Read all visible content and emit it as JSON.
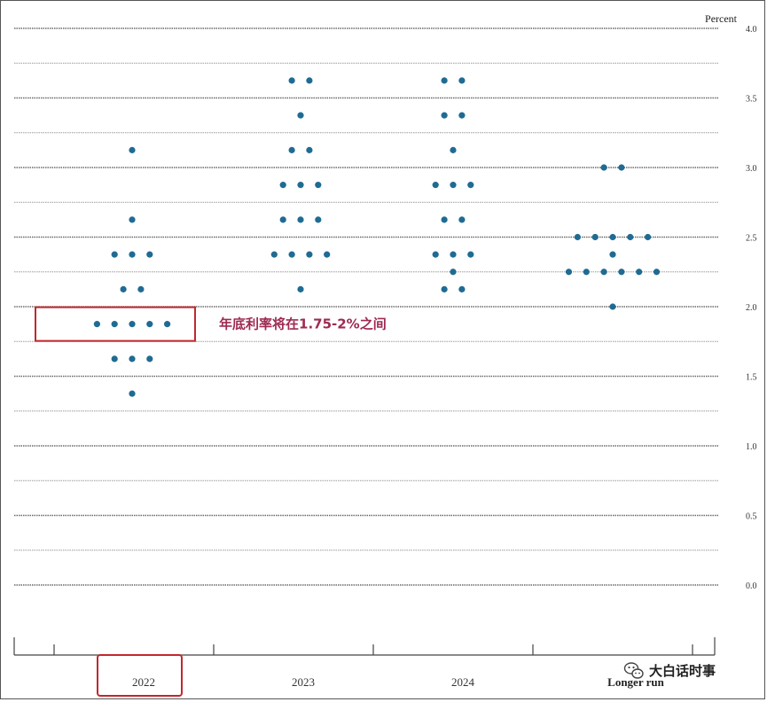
{
  "chart_data": {
    "type": "scatter",
    "y_unit_label": "Percent",
    "ylim": [
      0.0,
      4.0
    ],
    "y_ticks": [
      "0.0",
      "0.5",
      "1.0",
      "1.5",
      "2.0",
      "2.5",
      "3.0",
      "3.5",
      "4.0"
    ],
    "categories": [
      "2022",
      "2023",
      "2024",
      "Longer run"
    ],
    "grid": true,
    "marker_color": "#1f6b93",
    "dots": [
      {
        "category": "2022",
        "rate": 3.125,
        "count": 1
      },
      {
        "category": "2022",
        "rate": 2.625,
        "count": 1
      },
      {
        "category": "2022",
        "rate": 2.375,
        "count": 3
      },
      {
        "category": "2022",
        "rate": 2.125,
        "count": 2
      },
      {
        "category": "2022",
        "rate": 1.875,
        "count": 5
      },
      {
        "category": "2022",
        "rate": 1.625,
        "count": 3
      },
      {
        "category": "2022",
        "rate": 1.375,
        "count": 1
      },
      {
        "category": "2023",
        "rate": 3.625,
        "count": 2
      },
      {
        "category": "2023",
        "rate": 3.375,
        "count": 1
      },
      {
        "category": "2023",
        "rate": 3.125,
        "count": 2
      },
      {
        "category": "2023",
        "rate": 2.875,
        "count": 3
      },
      {
        "category": "2023",
        "rate": 2.625,
        "count": 3
      },
      {
        "category": "2023",
        "rate": 2.375,
        "count": 4
      },
      {
        "category": "2023",
        "rate": 2.125,
        "count": 1
      },
      {
        "category": "2024",
        "rate": 3.625,
        "count": 2
      },
      {
        "category": "2024",
        "rate": 3.375,
        "count": 2
      },
      {
        "category": "2024",
        "rate": 3.125,
        "count": 1
      },
      {
        "category": "2024",
        "rate": 2.875,
        "count": 3
      },
      {
        "category": "2024",
        "rate": 2.625,
        "count": 2
      },
      {
        "category": "2024",
        "rate": 2.375,
        "count": 3
      },
      {
        "category": "2024",
        "rate": 2.25,
        "count": 1
      },
      {
        "category": "2024",
        "rate": 2.125,
        "count": 2
      },
      {
        "category": "Longer run",
        "rate": 3.0,
        "count": 2
      },
      {
        "category": "Longer run",
        "rate": 2.5,
        "count": 5
      },
      {
        "category": "Longer run",
        "rate": 2.375,
        "count": 1
      },
      {
        "category": "Longer run",
        "rate": 2.25,
        "count": 6
      },
      {
        "category": "Longer run",
        "rate": 2.0,
        "count": 1
      }
    ],
    "annotation": {
      "text": "年底利率将在1.75-2%之间",
      "color": "#9e2a52",
      "box_color": "#c0282d",
      "category": "2022",
      "rate": 1.875
    },
    "highlight_category": "2022"
  },
  "watermark": {
    "text": "大白话时事",
    "icon": "wechat-icon"
  }
}
